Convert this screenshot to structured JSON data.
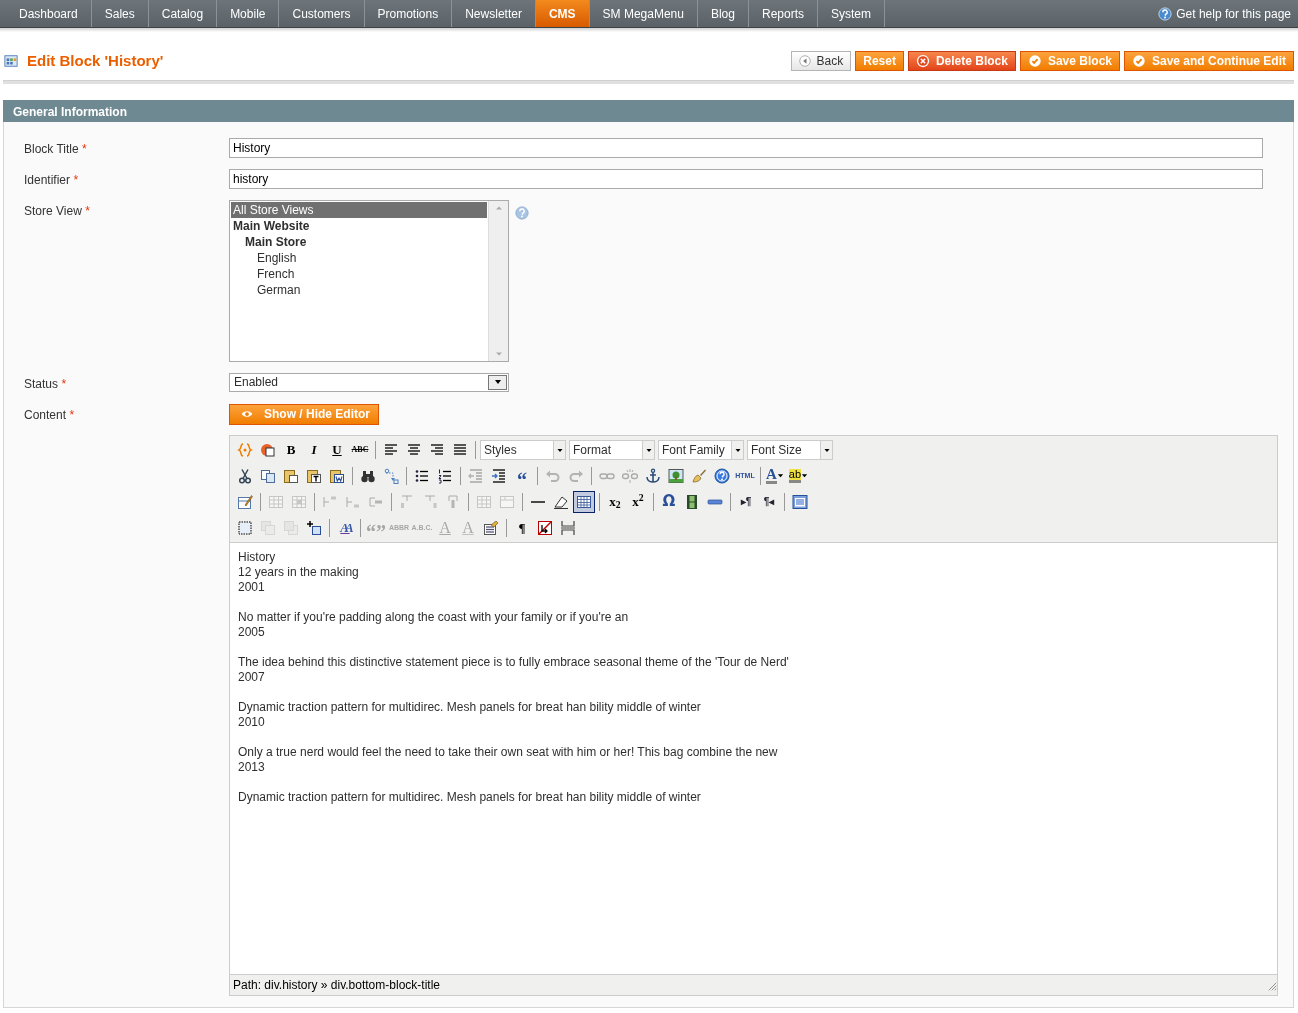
{
  "nav": {
    "items": [
      {
        "label": "Dashboard",
        "selected": false
      },
      {
        "label": "Sales",
        "selected": false
      },
      {
        "label": "Catalog",
        "selected": false
      },
      {
        "label": "Mobile",
        "selected": false
      },
      {
        "label": "Customers",
        "selected": false
      },
      {
        "label": "Promotions",
        "selected": false
      },
      {
        "label": "Newsletter",
        "selected": false
      },
      {
        "label": "CMS",
        "selected": true
      },
      {
        "label": "SM MegaMenu",
        "selected": false
      },
      {
        "label": "Blog",
        "selected": false
      },
      {
        "label": "Reports",
        "selected": false
      },
      {
        "label": "System",
        "selected": false
      }
    ],
    "help": "Get help for this page"
  },
  "header": {
    "title": "Edit Block 'History'",
    "buttons": [
      {
        "label": "Back",
        "kind": "back"
      },
      {
        "label": "Reset",
        "kind": "plain"
      },
      {
        "label": "Delete Block",
        "kind": "delete"
      },
      {
        "label": "Save Block",
        "kind": "save"
      },
      {
        "label": "Save and Continue Edit",
        "kind": "save"
      }
    ]
  },
  "section": {
    "title": "General Information",
    "fields": [
      {
        "label": "Block Title",
        "required_mark": "*",
        "kind": "text",
        "value": "History"
      },
      {
        "label": "Identifier",
        "required_mark": "*",
        "kind": "text",
        "value": "history"
      },
      {
        "label": "Store View",
        "required_mark": "*",
        "kind": "multiselect",
        "options": [
          {
            "label": "All Store Views",
            "selected": true
          },
          {
            "label": "Main Website",
            "selected": false,
            "children": [
              {
                "label": "Main Store",
                "selected": false,
                "children": [
                  {
                    "label": "English",
                    "selected": false
                  },
                  {
                    "label": "French",
                    "selected": false
                  },
                  {
                    "label": "German",
                    "selected": false
                  }
                ]
              }
            ]
          }
        ]
      },
      {
        "label": "Status",
        "required_mark": "*",
        "kind": "select",
        "value": "Enabled"
      },
      {
        "label": "Content",
        "required_mark": "*",
        "kind": "editor",
        "toggle": "Show / Hide Editor"
      }
    ]
  },
  "editor": {
    "toolbar": [
      [
        {
          "kind": "icon",
          "disabled": false,
          "active": false
        },
        {
          "kind": "icon",
          "disabled": false,
          "active": false
        },
        {
          "kind": "bold",
          "label": "B",
          "disabled": false,
          "active": false
        },
        {
          "kind": "italic",
          "label": "I",
          "disabled": false,
          "active": false
        },
        {
          "kind": "underline",
          "label": "U",
          "disabled": false,
          "active": false
        },
        {
          "kind": "strike",
          "label": "ABC",
          "disabled": false,
          "active": false
        },
        {
          "kind": "separator"
        },
        {
          "kind": "icon",
          "disabled": false,
          "active": false
        },
        {
          "kind": "icon",
          "disabled": false,
          "active": false
        },
        {
          "kind": "icon",
          "disabled": false,
          "active": false
        },
        {
          "kind": "icon",
          "disabled": false,
          "active": false
        },
        {
          "kind": "separator"
        },
        {
          "kind": "dropdown",
          "label": "Styles"
        },
        {
          "kind": "dropdown",
          "label": "Format"
        },
        {
          "kind": "dropdown",
          "label": "Font Family"
        },
        {
          "kind": "dropdown",
          "label": "Font Size"
        }
      ],
      [
        {
          "kind": "icon",
          "disabled": false,
          "active": false
        },
        {
          "kind": "icon",
          "disabled": false,
          "active": false
        },
        {
          "kind": "icon",
          "disabled": false,
          "active": false
        },
        {
          "kind": "icon",
          "disabled": false,
          "active": false
        },
        {
          "kind": "icon",
          "disabled": false,
          "active": false
        },
        {
          "kind": "separator"
        },
        {
          "kind": "icon",
          "disabled": false,
          "active": false
        },
        {
          "kind": "icon",
          "disabled": false,
          "active": false
        },
        {
          "kind": "separator"
        },
        {
          "kind": "icon",
          "disabled": false,
          "active": false
        },
        {
          "kind": "icon",
          "disabled": false,
          "active": false
        },
        {
          "kind": "separator"
        },
        {
          "kind": "icon",
          "disabled": true,
          "active": false
        },
        {
          "kind": "icon",
          "disabled": false,
          "active": false
        },
        {
          "kind": "quote",
          "label": "“",
          "disabled": false,
          "active": false
        },
        {
          "kind": "separator"
        },
        {
          "kind": "icon",
          "disabled": true,
          "active": false
        },
        {
          "kind": "icon",
          "disabled": true,
          "active": false
        },
        {
          "kind": "separator"
        },
        {
          "kind": "icon",
          "disabled": true,
          "active": false
        },
        {
          "kind": "icon",
          "disabled": true,
          "active": false
        },
        {
          "kind": "icon",
          "disabled": false,
          "active": false
        },
        {
          "kind": "icon",
          "disabled": false,
          "active": false
        },
        {
          "kind": "icon",
          "disabled": false,
          "active": false
        },
        {
          "kind": "icon",
          "disabled": false,
          "active": false
        },
        {
          "kind": "tiny",
          "label": "HTML",
          "disabled": false,
          "active": false
        },
        {
          "kind": "separator"
        },
        {
          "kind": "forecolor",
          "label": "A",
          "disabled": false,
          "active": false
        },
        {
          "kind": "highlight",
          "label": "ab",
          "disabled": false,
          "active": false
        }
      ],
      [
        {
          "kind": "icon",
          "disabled": false,
          "active": false
        },
        {
          "kind": "separator"
        },
        {
          "kind": "icon",
          "disabled": true,
          "active": false
        },
        {
          "kind": "icon",
          "disabled": true,
          "active": false
        },
        {
          "kind": "separator"
        },
        {
          "kind": "icon",
          "disabled": true,
          "active": false
        },
        {
          "kind": "icon",
          "disabled": true,
          "active": false
        },
        {
          "kind": "icon",
          "disabled": true,
          "active": false
        },
        {
          "kind": "separator"
        },
        {
          "kind": "icon",
          "disabled": true,
          "active": false
        },
        {
          "kind": "icon",
          "disabled": true,
          "active": false
        },
        {
          "kind": "icon",
          "disabled": true,
          "active": false
        },
        {
          "kind": "separator"
        },
        {
          "kind": "icon",
          "disabled": true,
          "active": false
        },
        {
          "kind": "icon",
          "disabled": true,
          "active": false
        },
        {
          "kind": "separator"
        },
        {
          "kind": "icon",
          "disabled": false,
          "active": false
        },
        {
          "kind": "icon",
          "disabled": false,
          "active": false
        },
        {
          "kind": "icon",
          "disabled": false,
          "active": true
        },
        {
          "kind": "separator"
        },
        {
          "kind": "bold",
          "label": "x$_{2}$",
          "disabled": false,
          "active": false
        },
        {
          "kind": "bold",
          "label": "x$^{2}$",
          "disabled": false,
          "active": false
        },
        {
          "kind": "separator"
        },
        {
          "kind": "omega",
          "label": "Ω",
          "disabled": false,
          "active": false
        },
        {
          "kind": "icon",
          "disabled": false,
          "active": false
        },
        {
          "kind": "icon",
          "disabled": false,
          "active": false
        },
        {
          "kind": "separator"
        },
        {
          "kind": "small-bold",
          "label": "▸¶",
          "disabled": false,
          "active": false
        },
        {
          "kind": "small-bold",
          "label": "¶◂",
          "disabled": false,
          "active": false
        },
        {
          "kind": "separator"
        },
        {
          "kind": "icon",
          "disabled": false,
          "active": false
        }
      ],
      [
        {
          "kind": "icon",
          "disabled": false,
          "active": false
        },
        {
          "kind": "icon",
          "disabled": true,
          "active": false
        },
        {
          "kind": "icon",
          "disabled": true,
          "active": false
        },
        {
          "kind": "icon",
          "disabled": false,
          "active": false
        },
        {
          "kind": "separator"
        },
        {
          "kind": "styleprops",
          "label": "AA",
          "disabled": false,
          "active": false
        },
        {
          "kind": "separator"
        },
        {
          "kind": "quote",
          "label": "“”",
          "disabled": true,
          "active": false
        },
        {
          "kind": "tiny",
          "label": "ABBR",
          "disabled": true,
          "active": false
        },
        {
          "kind": "tiny",
          "label": "A.B.C.",
          "disabled": true,
          "active": false
        },
        {
          "kind": "del",
          "label": "A",
          "disabled": true,
          "active": false
        },
        {
          "kind": "ins",
          "label": "A",
          "disabled": true,
          "active": false
        },
        {
          "kind": "icon",
          "disabled": false,
          "active": false
        },
        {
          "kind": "separator"
        },
        {
          "kind": "bold",
          "label": "¶",
          "disabled": false,
          "active": false
        },
        {
          "kind": "icon",
          "disabled": false,
          "active": false
        },
        {
          "kind": "icon",
          "disabled": false,
          "active": false
        }
      ]
    ],
    "paragraphs": [
      [
        "History",
        "12 years in the making",
        "2001"
      ],
      [
        "No matter if you're padding along the coast with your family or if you're an",
        "2005"
      ],
      [
        "The idea behind this distinctive statement piece is to fully embrace seasonal theme of the 'Tour de Nerd'",
        "2007"
      ],
      [
        "Dynamic traction pattern for multidirec. Mesh panels for breat han bility middle of winter",
        "2010"
      ],
      [
        "Only a true nerd would feel the need to take their own seat with him or her! This bag combine the new",
        "2013"
      ],
      [
        "Dynamic traction pattern for multidirec. Mesh panels for breat han bility middle of winter"
      ]
    ],
    "path": "Path: div.history » div.bottom-block-title"
  }
}
